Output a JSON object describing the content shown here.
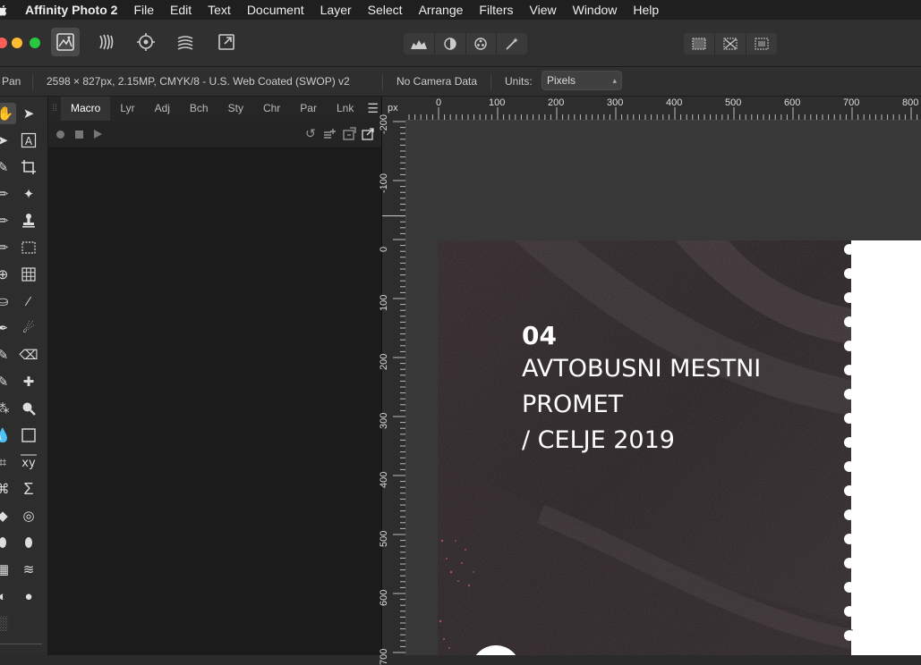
{
  "menubar": {
    "app_name": "Affinity Photo 2",
    "items": [
      "File",
      "Edit",
      "Text",
      "Document",
      "Layer",
      "Select",
      "Arrange",
      "Filters",
      "View",
      "Window",
      "Help"
    ]
  },
  "context_toolbar": {
    "tool_name": "Pan",
    "document_info": "2598 × 827px, 2.15MP, CMYK/8 - U.S. Web Coated (SWOP) v2",
    "camera_data": "No Camera Data",
    "units_label": "Units:",
    "units_value": "Pixels"
  },
  "panel": {
    "tabs": [
      "Macro",
      "Lyr",
      "Adj",
      "Bch",
      "Sty",
      "Chr",
      "Par",
      "Lnk"
    ],
    "active_tab": "Macro"
  },
  "ruler": {
    "unit": "px",
    "top_labels": [
      "0",
      "100",
      "200",
      "300",
      "400",
      "500",
      "600",
      "700",
      "800"
    ],
    "left_labels": [
      "-200",
      "-100",
      "0",
      "100",
      "200",
      "300",
      "400",
      "500",
      "600",
      "700"
    ]
  },
  "document": {
    "number": "04",
    "line1": "AVTOBUSNI MESTNI",
    "line2": "PROMET",
    "line3": "/ CELJE 2019"
  },
  "colors": {
    "traffic_close": "#fe5f57",
    "traffic_min": "#febc2e",
    "traffic_max": "#28c840",
    "canvas_bg": "#383838",
    "artwork_dark": "#2a2225"
  }
}
